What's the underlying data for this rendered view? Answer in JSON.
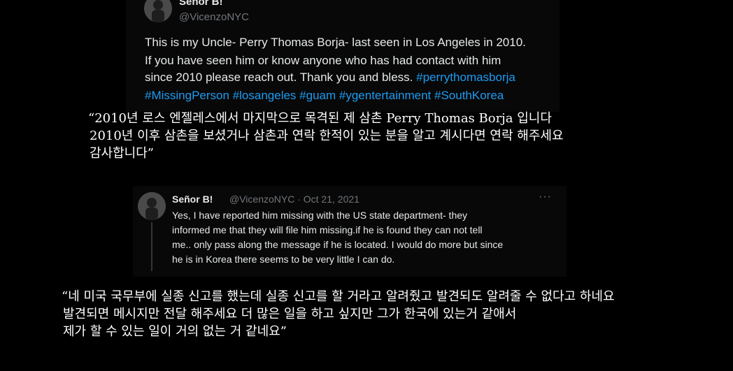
{
  "tweet": {
    "name": "Señor B!",
    "handle": "@VicenzoNYC",
    "lines": [
      "This is my Uncle- Perry Thomas Borja- last seen in Los Angeles in 2010.",
      "If you have seen him or know anyone who has had contact with him",
      "since 2010 please reach out. Thank you and bless."
    ],
    "line3_tag": "#perrythomasborja",
    "hashtags": [
      "#MissingPerson",
      "#losangeles",
      "#guam",
      "#ygentertainment",
      "#SouthKorea"
    ]
  },
  "subtitle1": [
    "“2010년 로스 엔젤레스에서 마지막으로 목격된 제 삼촌 Perry Thomas Borja 입니다",
    "2010년 이후 삼촌을 보셨거나 삼촌과 연락 한적이 있는 분을 알고 계시다면 연락 해주세요",
    "감사합니다”"
  ],
  "reply": {
    "name": "Señor B!",
    "meta": "@VicenzoNYC · Oct 21, 2021",
    "more": "···",
    "lines": [
      "Yes, I have reported him missing with the US state department- they",
      "informed me that they will file him missing.if he is found they can not tell",
      "me.. only pass along the message if he is located. I would do more but since",
      "he is in Korea there seems to be very little I can do."
    ]
  },
  "subtitle2": [
    "“네 미국 국무부에 실종 신고를 했는데 실종 신고를 할 거라고 알려줬고 발견되도 알려줄 수 없다고 하네요",
    "발견되면 메시지만 전달 해주세요 더 많은 일을 하고 싶지만 그가 한국에 있는거 같애서",
    "제가 할 수 있는 일이 거의 없는 거 같네요”"
  ],
  "colors": {
    "link": "#1d9bf0",
    "muted": "#71767b",
    "text": "#e7e9ea",
    "background": "#000000"
  },
  "icons": {
    "avatar": "profile-photo",
    "more": "more-options-icon"
  }
}
